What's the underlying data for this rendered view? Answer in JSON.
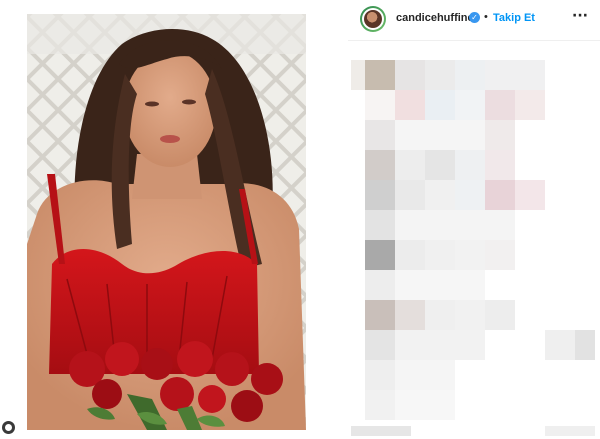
{
  "post": {
    "username": "candicehuffine",
    "verified": true,
    "separator": "•",
    "follow_label": "Takip Et",
    "more_icon": "more-horizontal-icon",
    "accent_color": "#0095f6",
    "verified_color": "#3897f0"
  },
  "photo": {
    "subject": "photo-post"
  }
}
